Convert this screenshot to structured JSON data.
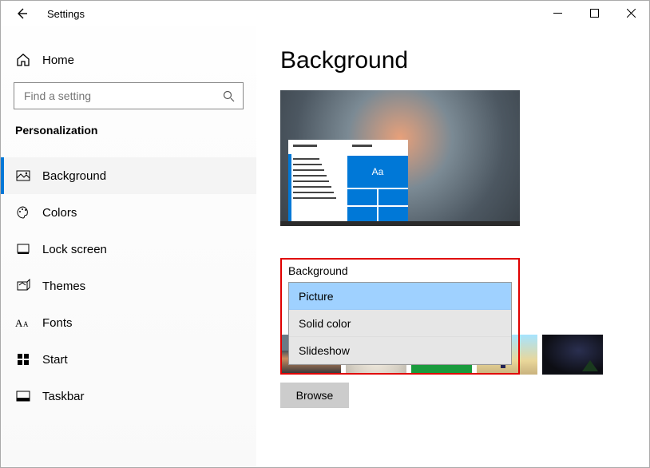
{
  "window": {
    "title": "Settings"
  },
  "sidebar": {
    "home": "Home",
    "search_placeholder": "Find a setting",
    "section": "Personalization",
    "items": [
      {
        "label": "Background",
        "selected": true,
        "icon": "picture-icon"
      },
      {
        "label": "Colors",
        "selected": false,
        "icon": "palette-icon"
      },
      {
        "label": "Lock screen",
        "selected": false,
        "icon": "lockscreen-icon"
      },
      {
        "label": "Themes",
        "selected": false,
        "icon": "themes-icon"
      },
      {
        "label": "Fonts",
        "selected": false,
        "icon": "fonts-icon"
      },
      {
        "label": "Start",
        "selected": false,
        "icon": "start-icon"
      },
      {
        "label": "Taskbar",
        "selected": false,
        "icon": "taskbar-icon"
      }
    ]
  },
  "main": {
    "title": "Background",
    "preview_sample_text": "Aa",
    "dropdown": {
      "label": "Background",
      "options": [
        "Picture",
        "Solid color",
        "Slideshow"
      ],
      "selected": "Picture"
    },
    "browse_label": "Browse"
  }
}
